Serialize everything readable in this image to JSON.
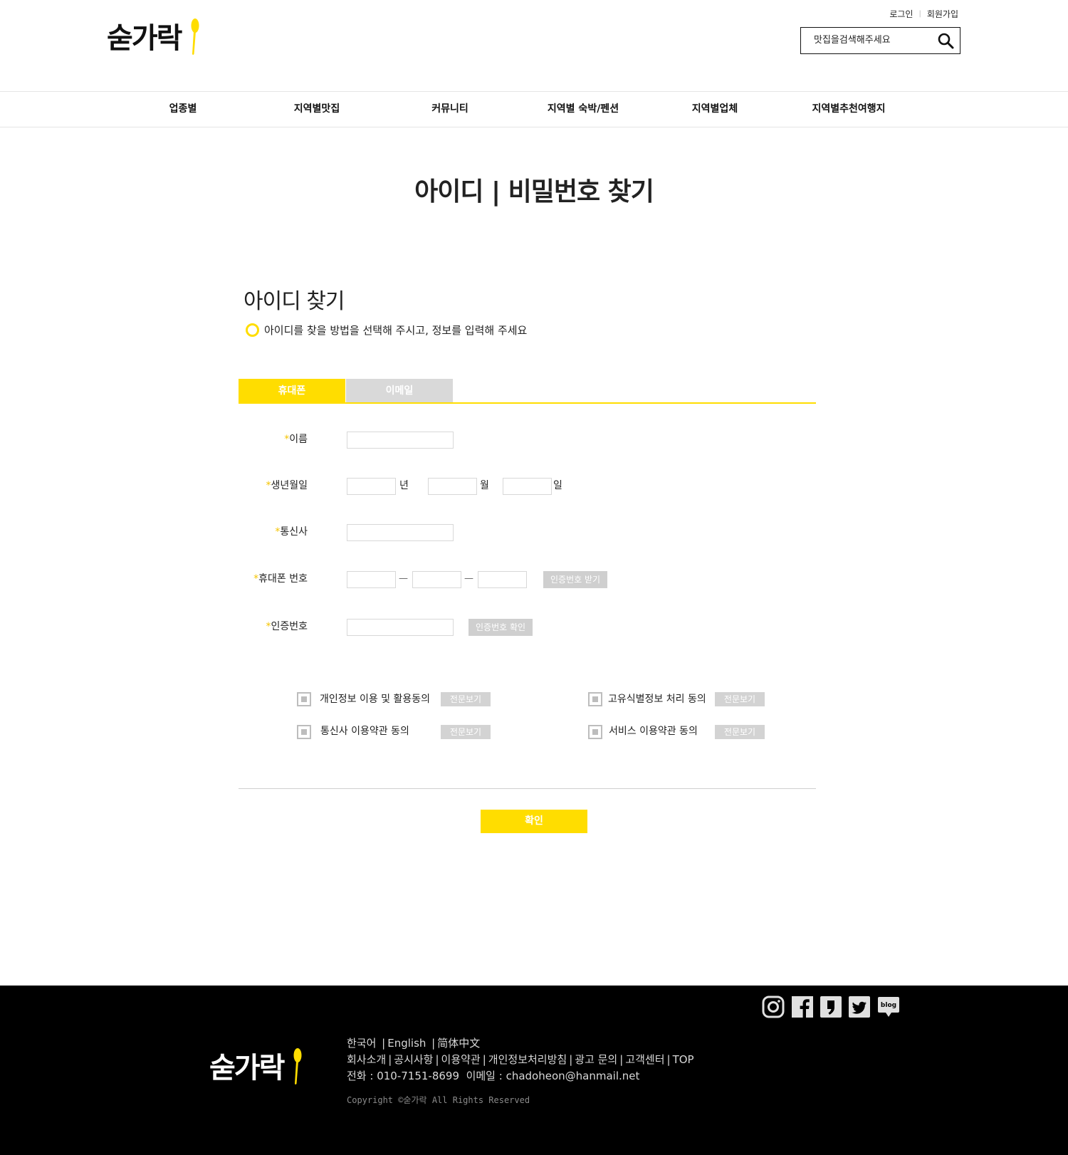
{
  "header": {
    "logo_text": "숟가락",
    "login": "로그인",
    "signup": "회원가입",
    "search_placeholder": "맛집을검색해주세요"
  },
  "nav": {
    "items": [
      "업종별",
      "지역별맛집",
      "커뮤니티",
      "지역별 숙박/펜션",
      "지역별업체",
      "지역별추천여행지"
    ]
  },
  "page_title": "아이디 | 비밀번호 찾기",
  "section": {
    "title": "아이디 찾기",
    "notice": "아이디를 찾을 방법을 선택해 주시고, 정보를 입력해 주세요"
  },
  "tabs": [
    "휴대폰",
    "이메일"
  ],
  "form": {
    "required_mark": "*",
    "name_label": "이름",
    "birth_label": "생년월일",
    "birth_year_unit": "년",
    "birth_month_unit": "월",
    "birth_day_unit": "일",
    "carrier_label": "통신사",
    "phone_label": "휴대폰 번호",
    "phone_dash": "—",
    "request_code_button": "인증번호 받기",
    "code_label": "인증번호",
    "verify_code_button": "인증번호 확인"
  },
  "agreements": {
    "view_label": "전문보기",
    "items": [
      "개인정보 이용 및 활용동의",
      "고유식별정보 처리 동의",
      "통신사 이용약관 동의",
      "서비스 이용약관 동의"
    ]
  },
  "confirm_button": "확인",
  "footer": {
    "logo_text": "숟가락",
    "languages": [
      "한국어",
      "English",
      "简体中文"
    ],
    "links": [
      "회사소개",
      "공시사항",
      "이용약관",
      "개인정보처리방침",
      "광고 문의",
      "고객센터",
      "TOP"
    ],
    "phone_label": "전화 :",
    "phone": "010-7151-8699",
    "email_label": "이메일 :",
    "email": "chadoheon@hanmail.net",
    "copyright": "Copyright ©숟가락  All Rights Reserved",
    "sns_icons": [
      "instagram-icon",
      "facebook-icon",
      "kakao-story-icon",
      "twitter-icon",
      "blog-icon"
    ],
    "blog_icon_text": "blog"
  },
  "colors": {
    "accent": "#ffdd00",
    "inactive_tab": "#d9d9d9",
    "button_gray": "#cfcfcf",
    "footer_bg": "#000000"
  }
}
